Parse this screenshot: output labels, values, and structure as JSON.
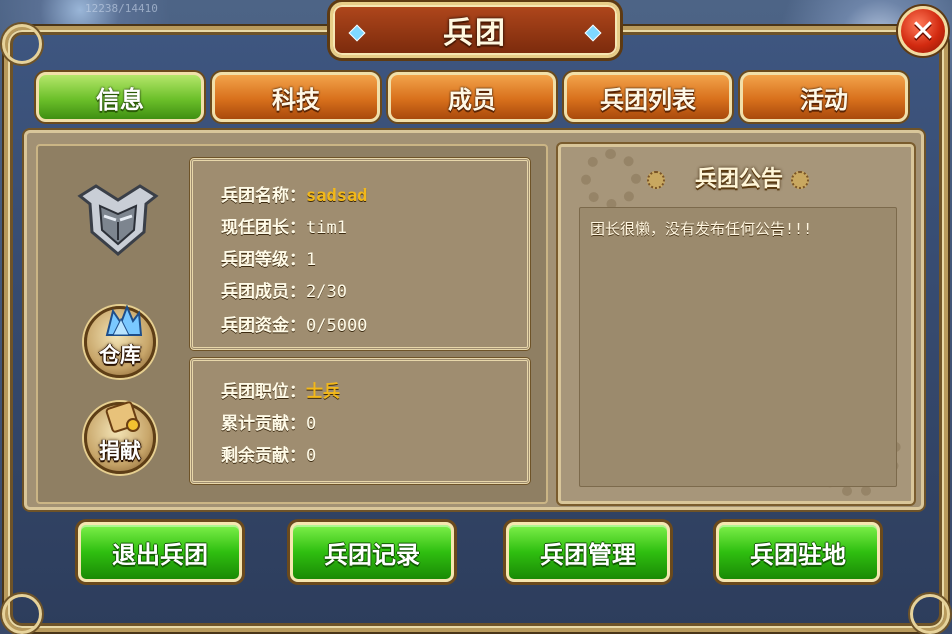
{
  "window": {
    "title": "兵团",
    "close_label": "✕",
    "bg_text": "12238/14410"
  },
  "tabs": [
    {
      "label": "信息",
      "active": true
    },
    {
      "label": "科技",
      "active": false
    },
    {
      "label": "成员",
      "active": false
    },
    {
      "label": "兵团列表",
      "active": false
    },
    {
      "label": "活动",
      "active": false
    }
  ],
  "side_icons": {
    "warehouse_label": "仓库",
    "donate_label": "捐献"
  },
  "info": {
    "name_label": "兵团名称：",
    "name_value": "sadsad",
    "leader_label": "现任团长：",
    "leader_value": "tim1",
    "level_label": "兵团等级：",
    "level_value": "1",
    "members_label": "兵团成员：",
    "members_value": "2/30",
    "funds_label": "兵团资金：",
    "funds_value": "0/5000"
  },
  "personal": {
    "position_label": "兵团职位：",
    "position_value": "士兵",
    "total_contrib_label": "累计贡献：",
    "total_contrib_value": "0",
    "remaining_contrib_label": "剩余贡献：",
    "remaining_contrib_value": "0"
  },
  "notice": {
    "title": "兵团公告",
    "text": "团长很懒，没有发布任何公告!!!"
  },
  "actions": [
    {
      "label": "退出兵团"
    },
    {
      "label": "兵团记录"
    },
    {
      "label": "兵团管理"
    },
    {
      "label": "兵团驻地"
    }
  ],
  "colors": {
    "tab_active": "#6cc02a",
    "tab_inactive": "#d8701c",
    "action_button": "#2fbf10",
    "highlight_value": "#f2b81a",
    "close_button": "#d22a10"
  }
}
